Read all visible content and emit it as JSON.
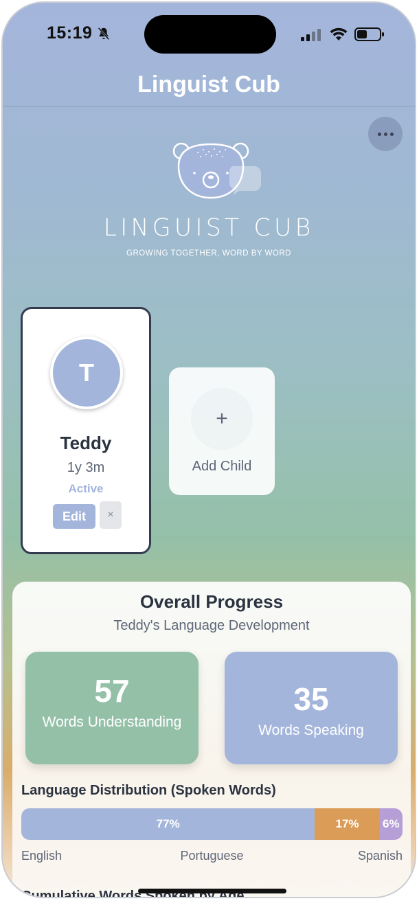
{
  "status_bar": {
    "time": "15:19"
  },
  "header": {
    "title": "Linguist Cub"
  },
  "logo": {
    "wordmark": "LINGUIST CUB",
    "tagline": "GROWING TOGETHER, WORD BY WORD"
  },
  "children": [
    {
      "initial": "T",
      "name": "Teddy",
      "age": "1y 3m",
      "status": "Active",
      "edit_label": "Edit",
      "remove_label": "×"
    }
  ],
  "add_child": {
    "plus": "+",
    "label": "Add Child"
  },
  "progress": {
    "title": "Overall Progress",
    "subtitle": "Teddy's Language Development",
    "understanding": {
      "count": "57",
      "label": "Words Understanding"
    },
    "speaking": {
      "count": "35",
      "label": "Words Speaking"
    },
    "distribution_title": "Language Distribution (Spoken Words)",
    "distribution": [
      {
        "language": "English",
        "percent": 77,
        "display": "77%"
      },
      {
        "language": "Portuguese",
        "percent": 17,
        "display": "17%"
      },
      {
        "language": "Spanish",
        "percent": 6,
        "display": "6%"
      }
    ],
    "cumulative_title": "Cumulative Words Spoken by Age"
  },
  "colors": {
    "accent_blue": "#a4b5dc",
    "accent_green": "#95c0a8",
    "accent_orange": "#db9c58",
    "accent_purple": "#b59fd6",
    "text_dark": "#2b3340"
  }
}
